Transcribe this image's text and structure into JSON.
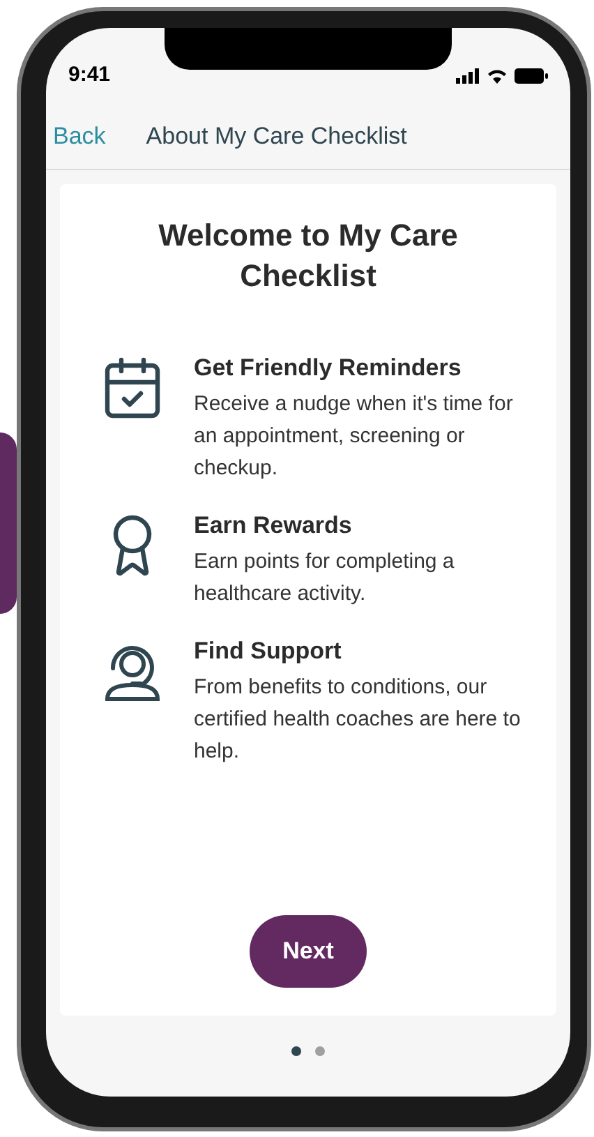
{
  "status_bar": {
    "time": "9:41"
  },
  "nav": {
    "back": "Back",
    "title": "About My Care Checklist"
  },
  "card": {
    "title": "Welcome to My Care Checklist",
    "features": [
      {
        "kind": "calendar",
        "title": "Get Friendly Reminders",
        "text": "Receive a nudge when it's time for an appointment, screening or checkup."
      },
      {
        "kind": "award",
        "title": "Earn Rewards",
        "text": "Earn points for completing a healthcare activity."
      },
      {
        "kind": "support",
        "title": "Find Support",
        "text": "From benefits to conditions, our certified health coaches are here to help."
      }
    ],
    "button": "Next"
  },
  "pager": [
    {
      "selected": true
    },
    {
      "selected": false
    }
  ]
}
